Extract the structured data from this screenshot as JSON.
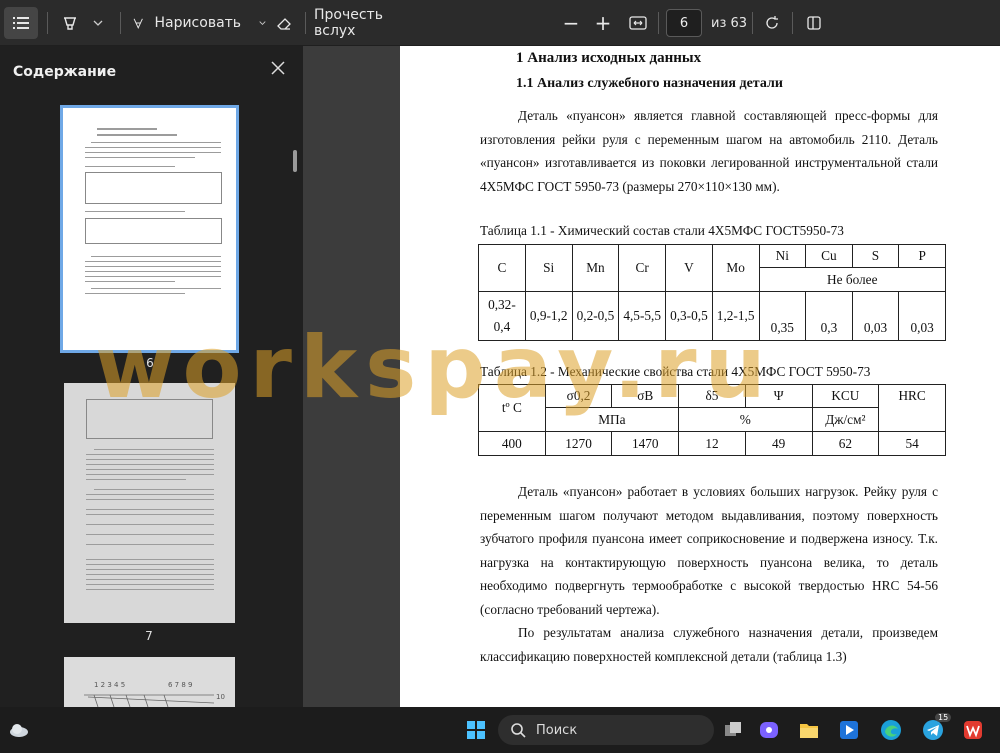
{
  "toolbar": {
    "draw_label": "Нарисовать",
    "read_aloud_label": "Прочесть вслух",
    "page_current": "6",
    "page_total": "из 63",
    "zoom_out": "−",
    "zoom_in": "+"
  },
  "sidebar": {
    "title": "Содержание",
    "thumbnails": [
      {
        "number": "6"
      },
      {
        "number": "7"
      }
    ]
  },
  "document": {
    "heading1": "1 Анализ исходных данных",
    "heading2": "1.1 Анализ служебного назначения детали",
    "paragraph1": "Деталь «пуансон» является главной составляющей пресс-формы для изготовления рейки руля с переменным шагом на автомобиль 2110. Деталь «пуансон» изготавливается из поковки легированной инструментальной стали 4Х5МФС ГОСТ 5950-73 (размеры 270×110×130 мм).",
    "table1_caption": "Таблица 1.1 - Химический состав стали 4Х5МФС ГОСТ5950-73",
    "table1": {
      "top_headers": [
        "Ni",
        "Cu",
        "S",
        "P"
      ],
      "no_more": "Не более",
      "main_headers": [
        "C",
        "Si",
        "Mn",
        "Cr",
        "V",
        "Mo"
      ],
      "values": [
        "0,32-0,4",
        "0,9-1,2",
        "0,2-0,5",
        "4,5-5,5",
        "0,3-0,5",
        "1,2-1,5",
        "0,35",
        "0,3",
        "0,03",
        "0,03"
      ]
    },
    "table2_caption": "Таблица 1.2 - Механические свойства стали 4Х5МФС ГОСТ 5950-73",
    "table2": {
      "temp_header": "tº C",
      "sigma02": "σ0,2",
      "sigmaB": "σВ",
      "delta5": "δ5",
      "psi": "Ψ",
      "kcu": "KCU",
      "hrc": "HRC",
      "mpa": "МПа",
      "percent": "%",
      "kcu_unit": "Дж/см²",
      "values": [
        "400",
        "1270",
        "1470",
        "12",
        "49",
        "62",
        "54"
      ]
    },
    "paragraph2": "Деталь «пуансон» работает в условиях больших нагрузок. Рейку руля с переменным шагом получают методом выдавливания, поэтому поверхность зубчатого профиля пуансона имеет соприкосновение и подвержена износу. Т.к. нагрузка на контактирующую поверхность пуансона велика, то деталь необходимо подвергнуть термообработке с высокой твердостью HRC 54-56 (согласно требований чертежа).",
    "paragraph3": "По результатам анализа служебного назначения детали, произведем классификацию поверхностей комплексной детали (таблица 1.3)"
  },
  "watermark": "workspay.ru",
  "taskbar": {
    "search_label": "Поиск",
    "telegram_badge": "15"
  },
  "colors": {
    "toolbar_bg": "#2b2b2b",
    "sidebar_bg": "#202020",
    "accent": "#6fa8e6"
  }
}
